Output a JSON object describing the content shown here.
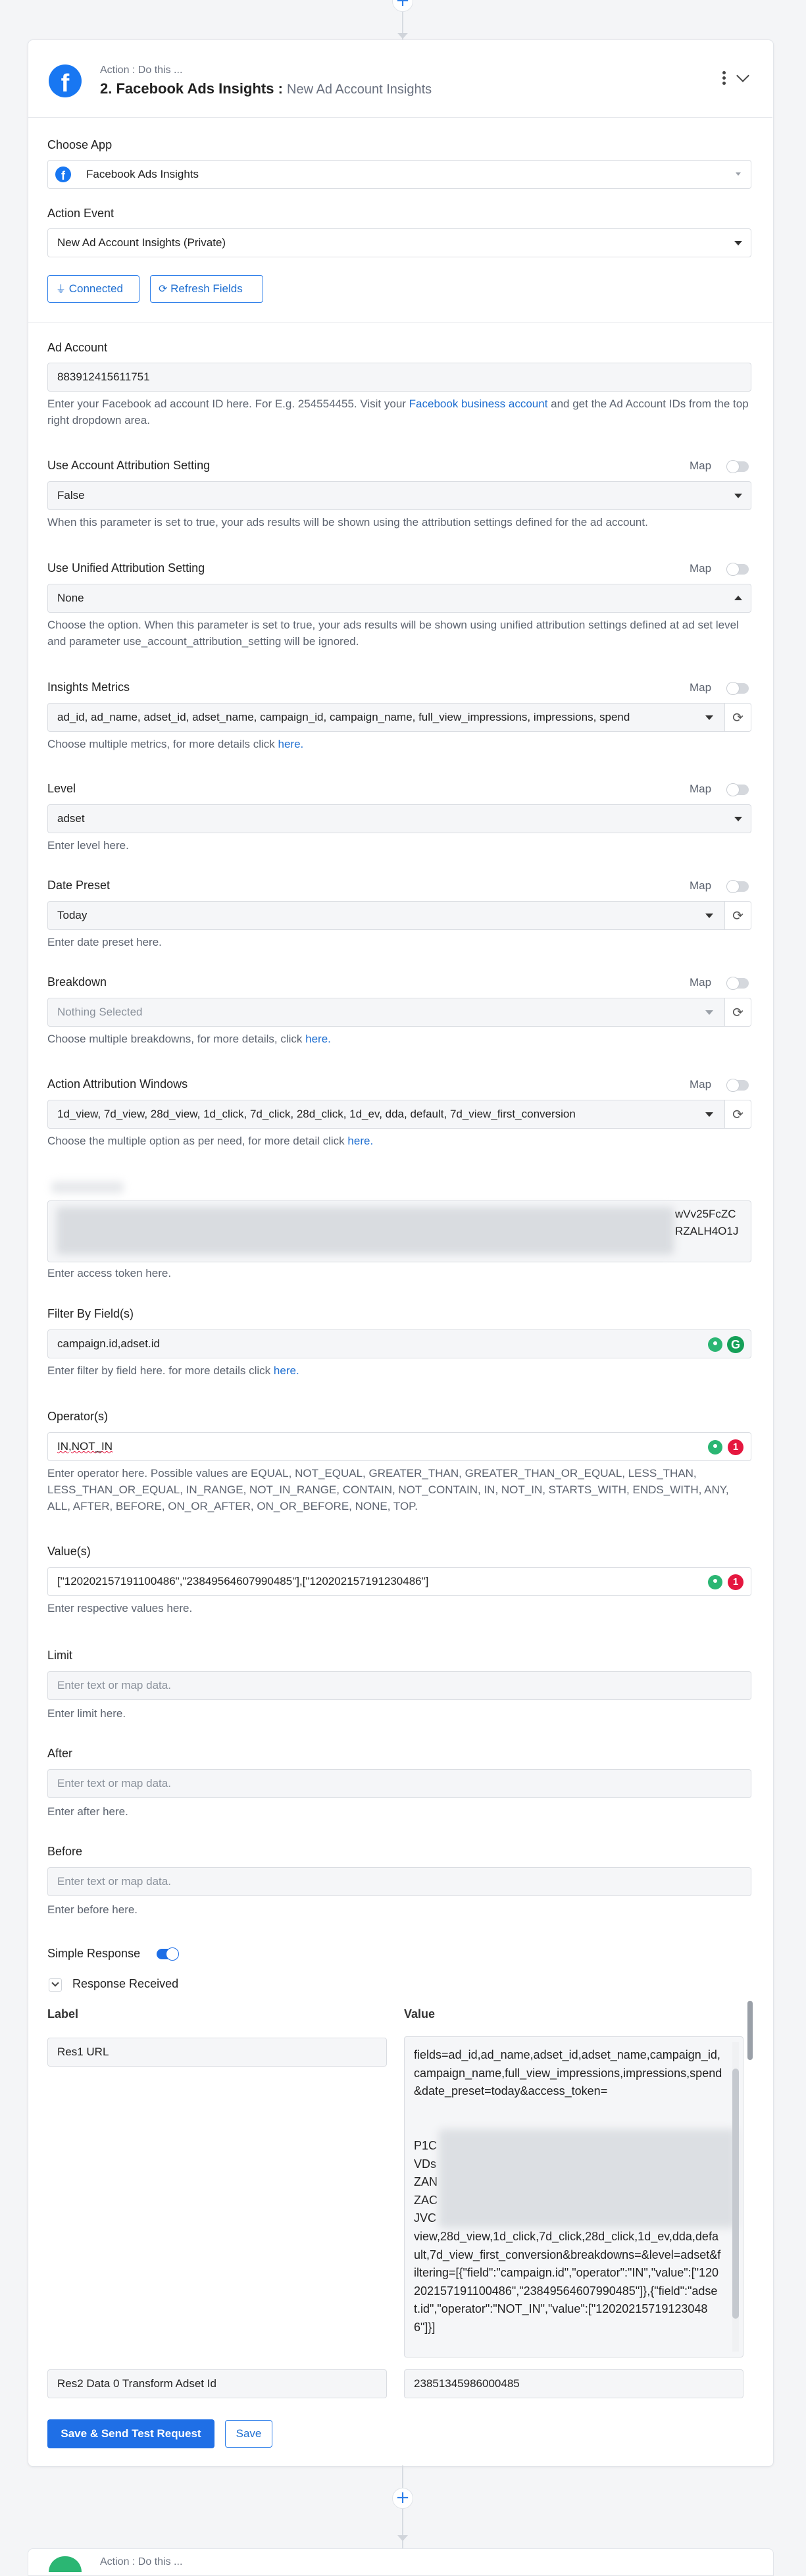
{
  "header": {
    "kicker": "Action : Do this ...",
    "title": "2. Facebook Ads Insights :",
    "subtitle": "New Ad Account Insights"
  },
  "choose_app": {
    "label": "Choose App",
    "value": "Facebook Ads Insights"
  },
  "action_event": {
    "label": "Action Event",
    "value": "New Ad Account Insights (Private)"
  },
  "buttons": {
    "connected": "Connected",
    "refresh_fields": "Refresh Fields",
    "save_send": "Save & Send Test Request",
    "save": "Save"
  },
  "ad_account": {
    "label": "Ad Account",
    "value": "883912415611751",
    "help_pre": "Enter your Facebook ad account ID here. For E.g. 254554455. Visit your ",
    "help_link": "Facebook business account",
    "help_post": " and get the Ad Account IDs from the top right dropdown area."
  },
  "map_label": "Map",
  "use_account_attr": {
    "label": "Use Account Attribution Setting",
    "value": "False",
    "help": "When this parameter is set to true, your ads results will be shown using the attribution settings defined for the ad account."
  },
  "use_unified_attr": {
    "label": "Use Unified Attribution Setting",
    "value": "None",
    "help": "Choose the option. When this parameter is set to true, your ads results will be shown using unified attribution settings defined at ad set level and parameter use_account_attribution_setting will be ignored."
  },
  "insights_metrics": {
    "label": "Insights Metrics",
    "value": "ad_id, ad_name, adset_id, adset_name, campaign_id, campaign_name, full_view_impressions, impressions, spend",
    "help_pre": "Choose multiple metrics, for more details click ",
    "help_link": "here."
  },
  "level": {
    "label": "Level",
    "value": "adset",
    "help": "Enter level here."
  },
  "date_preset": {
    "label": "Date Preset",
    "value": "Today",
    "help": "Enter date preset here."
  },
  "breakdown": {
    "label": "Breakdown",
    "placeholder": "Nothing Selected",
    "help_pre": "Choose multiple breakdowns, for more details, click ",
    "help_link": "here."
  },
  "action_attr_windows": {
    "label": "Action Attribution Windows",
    "value": "1d_view, 7d_view, 28d_view, 1d_click, 7d_click, 28d_click, 1d_ev, dda, default, 7d_view_first_conversion",
    "help_pre": "Choose the multiple option as per need, for more detail click ",
    "help_link": "here."
  },
  "access_token": {
    "visible_tail_1": "wVv25FcZC",
    "visible_tail_2": "RZALH4O1J",
    "help": "Enter access token here."
  },
  "filter_by_fields": {
    "label": "Filter By Field(s)",
    "value": "campaign.id,adset.id",
    "help_pre": "Enter filter by field here. for more details click ",
    "help_link": "here."
  },
  "operators": {
    "label": "Operator(s)",
    "value": "IN,NOT_IN",
    "help": "Enter operator here. Possible values are EQUAL, NOT_EQUAL, GREATER_THAN, GREATER_THAN_OR_EQUAL, LESS_THAN, LESS_THAN_OR_EQUAL, IN_RANGE, NOT_IN_RANGE, CONTAIN, NOT_CONTAIN, IN, NOT_IN, STARTS_WITH, ENDS_WITH, ANY, ALL, AFTER, BEFORE, ON_OR_AFTER, ON_OR_BEFORE, NONE, TOP.",
    "badge": "1"
  },
  "values": {
    "label": "Value(s)",
    "value": "[\"120202157191100486\",\"23849564607990485\"],[\"120202157191230486\"]",
    "help": "Enter respective values here.",
    "badge": "1"
  },
  "limit": {
    "label": "Limit",
    "placeholder": "Enter text or map data.",
    "help": "Enter limit here."
  },
  "after": {
    "label": "After",
    "placeholder": "Enter text or map data.",
    "help": "Enter after here."
  },
  "before": {
    "label": "Before",
    "placeholder": "Enter text or map data.",
    "help": "Enter before here."
  },
  "simple_response": {
    "label": "Simple Response"
  },
  "response": {
    "section_label": "Response Received",
    "col_label": "Label",
    "col_value": "Value",
    "rows": [
      {
        "label": "Res1 URL",
        "value_head": "fields=ad_id,ad_name,adset_id,adset_name,campaign_id,campaign_name,full_view_impressions,impressions,spend&date_preset=today&access_token=",
        "value_mid": "P1C\nVDs\nZAN\nZAC\nJVC",
        "value_tail": "view,28d_view,1d_click,7d_click,28d_click,1d_ev,dda,default,7d_view_first_conversion&breakdowns=&level=adset&filtering=[{\"field\":\"campaign.id\",\"operator\":\"IN\",\"value\":[\"120202157191100486\",\"23849564607990485\"]},{\"field\":\"adset.id\",\"operator\":\"NOT_IN\",\"value\":[\"120202157191230486\"]}]"
      },
      {
        "label": "Res2 Data 0 Transform  Adset Id",
        "value": "23851345986000485"
      }
    ]
  },
  "next_step": {
    "kicker": "Action : Do this ..."
  }
}
